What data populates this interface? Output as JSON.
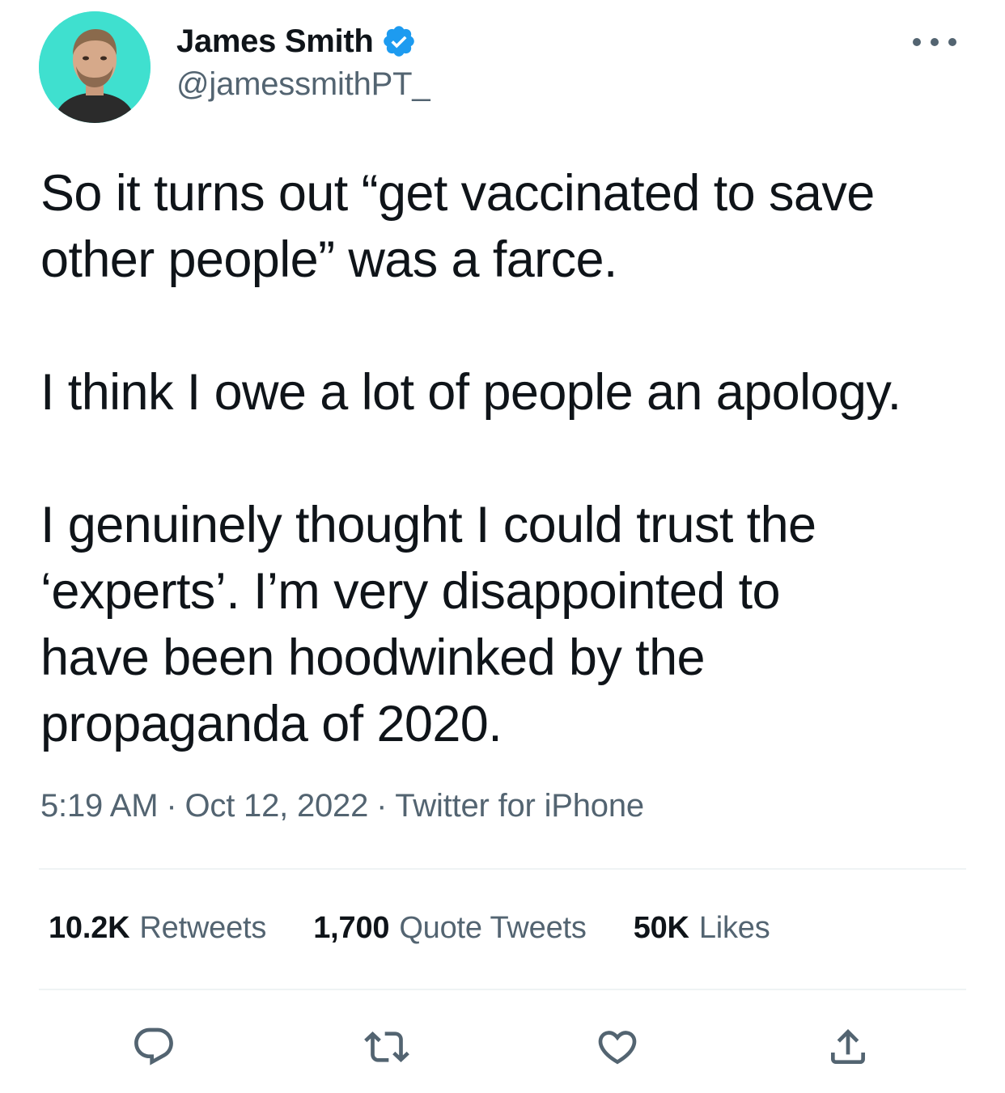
{
  "author": {
    "name": "James Smith",
    "handle": "@jamessmithPT_",
    "verified": true,
    "avatar": "profile-photo"
  },
  "tweet": {
    "paragraphs": [
      [
        "So it turns out “get vaccinated to save",
        "other people” was a farce."
      ],
      [
        "I think I owe a lot of people an apology."
      ],
      [
        "I genuinely thought I could trust the",
        "‘experts’. I’m very disappointed to",
        "have been hoodwinked by the",
        "propaganda of 2020."
      ]
    ]
  },
  "meta": {
    "time": "5:19 AM",
    "separator": "·",
    "date": "Oct 12, 2022",
    "source": "Twitter for iPhone"
  },
  "stats": {
    "retweets": {
      "count": "10.2K",
      "label": "Retweets"
    },
    "quotes": {
      "count": "1,700",
      "label": "Quote Tweets"
    },
    "likes": {
      "count": "50K",
      "label": "Likes"
    }
  },
  "actions": [
    "reply-icon",
    "retweet-icon",
    "like-icon",
    "share-icon"
  ],
  "colors": {
    "text": "#0f1419",
    "secondary": "#536471",
    "verified": "#1d9bf0",
    "divider": "#eff3f4",
    "avatar_bg": "#3fe0cf"
  }
}
